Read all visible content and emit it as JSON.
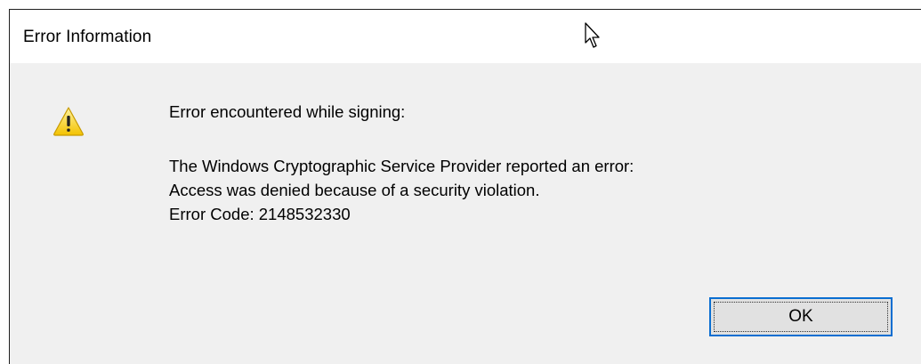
{
  "dialog": {
    "title": "Error Information",
    "heading": "Error encountered while signing:",
    "lines": [
      "The Windows Cryptographic Service Provider reported an error:",
      "Access was denied because of a security violation.",
      "Error Code: 2148532330"
    ],
    "ok_label": "OK",
    "icon": "warning-icon"
  },
  "colors": {
    "dialog_background": "#f0f0f0",
    "titlebar_background": "#ffffff",
    "button_border": "#0a6ed1",
    "button_background": "#e1e1e1"
  }
}
